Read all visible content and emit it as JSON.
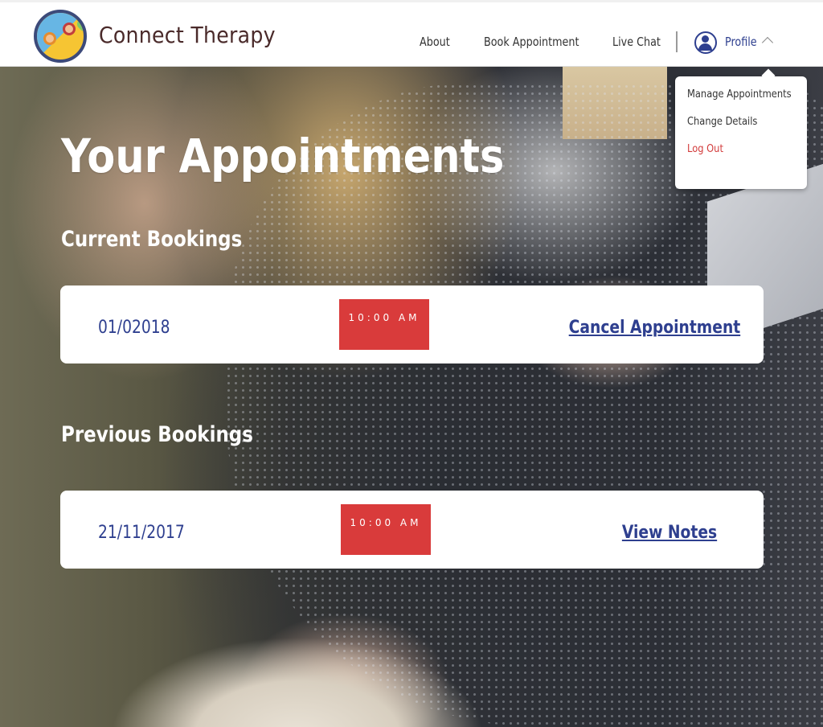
{
  "header": {
    "brand": "Connect Therapy",
    "nav": {
      "about": "About",
      "book": "Book Appointment",
      "chat": "Live Chat",
      "profile": "Profile"
    }
  },
  "dropdown": {
    "items": [
      "Manage Appointments",
      "Change Details",
      "Log Out"
    ]
  },
  "main": {
    "title": "Your Appointments",
    "current": {
      "heading": "Current Bookings",
      "date": "01/02018",
      "time": "10:00 AM",
      "action": "Cancel Appointment"
    },
    "previous": {
      "heading": "Previous Bookings",
      "date": "21/11/2017",
      "time": "10:00 AM",
      "action": "View Notes"
    }
  },
  "colors": {
    "accent_blue": "#2e3f8f",
    "badge_red": "#d93b3b",
    "logout_red": "#d23a3a"
  }
}
